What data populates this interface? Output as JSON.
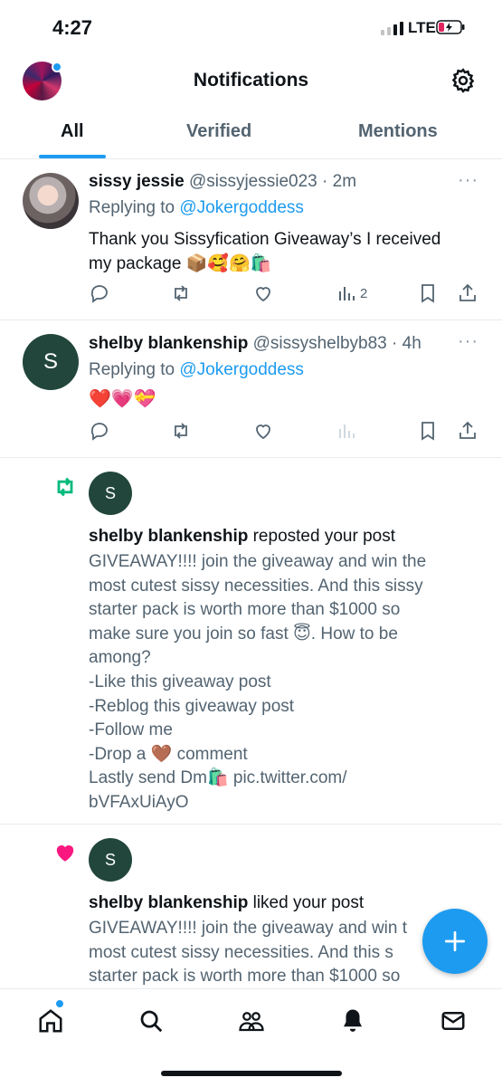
{
  "status_bar": {
    "time": "4:27",
    "network": "LTE"
  },
  "header": {
    "title": "Notifications"
  },
  "tabs": [
    {
      "label": "All"
    },
    {
      "label": "Verified"
    },
    {
      "label": "Mentions"
    }
  ],
  "notifications": [
    {
      "type": "reply",
      "display_name": "sissy jessie",
      "handle": "@sissyjessie023",
      "time": "2m",
      "replying_label": "Replying to",
      "replying_to": "@Jokergoddess",
      "text_line1": "Thank you Sissyfication Giveaway’s I received",
      "text_line2": "my package 📦🥰🤗🛍️",
      "views": "2"
    },
    {
      "type": "reply",
      "display_name": "shelby blankenship",
      "handle": "@sissyshelbyb83",
      "time": "4h",
      "avatar_letter": "S",
      "replying_label": "Replying to",
      "replying_to": "@Jokergoddess",
      "text_line1": "❤️💗💝"
    },
    {
      "type": "repost",
      "avatar_letter": "S",
      "actor": "shelby blankenship",
      "action": "reposted your post",
      "post_lines": [
        "GIVEAWAY!!!! join the giveaway and win the",
        "most cutest sissy necessities. And this sissy",
        "starter pack is worth more than $1000 so",
        "make sure you join so fast 😇. How to be",
        "among?",
        "-Like this giveaway post",
        "-Reblog this giveaway post",
        "-Follow me",
        "-Drop a 🤎 comment",
        "Lastly send Dm🛍️ pic.twitter.com/",
        "bVFAxUiAyO"
      ]
    },
    {
      "type": "like",
      "avatar_letter": "S",
      "actor": "shelby blankenship",
      "action": "liked your post",
      "post_lines": [
        "GIVEAWAY!!!! join the giveaway and win t",
        "most cutest sissy necessities. And this s",
        "starter pack is worth more than $1000 so"
      ]
    }
  ],
  "colors": {
    "accent": "#1d9bf0",
    "repost": "#00ba7c",
    "like": "#f91880",
    "avatar_bg": "#22463b"
  },
  "bottom_nav": [
    "home-icon",
    "search-icon",
    "communities-icon",
    "notifications-icon",
    "messages-icon"
  ]
}
